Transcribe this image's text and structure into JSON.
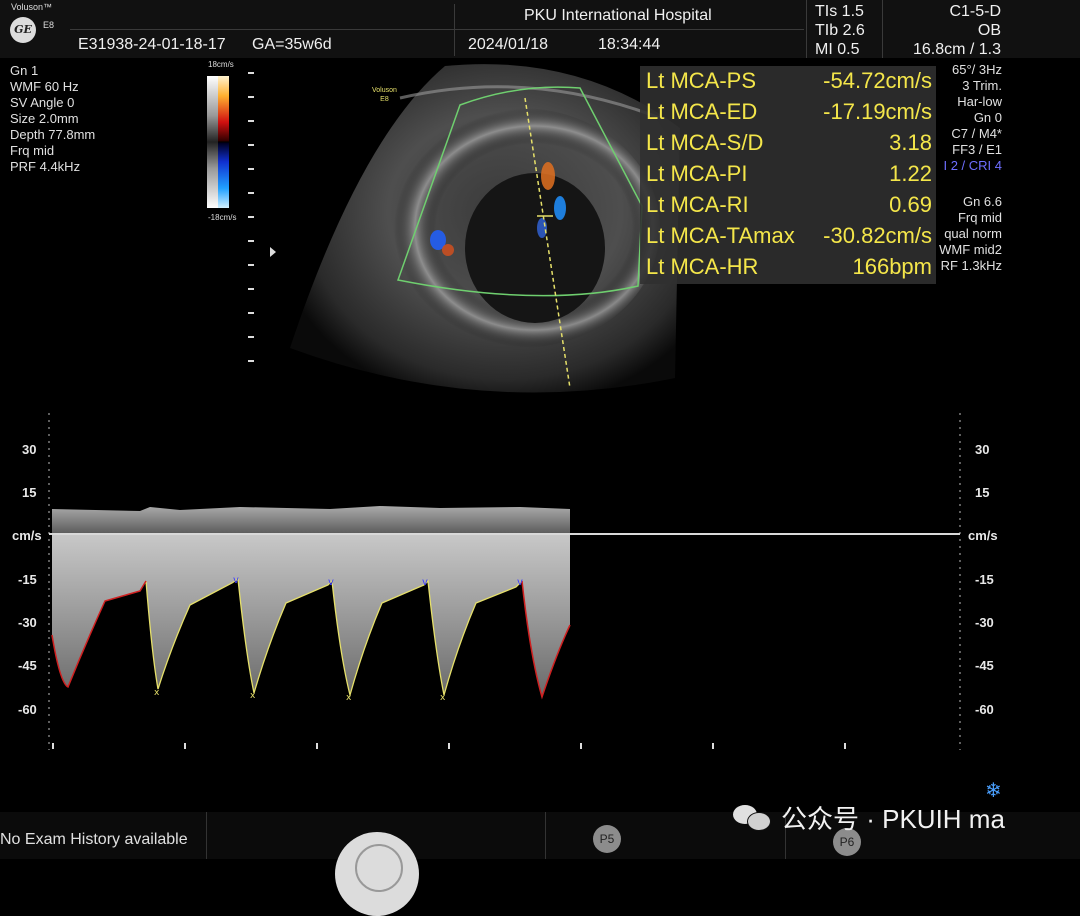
{
  "header": {
    "brand": "Voluson™",
    "brand_model": "E8",
    "logo": "GE",
    "patient_id": "E31938-24-01-18-17",
    "ga": "GA=35w6d",
    "hospital": "PKU International Hospital",
    "date": "2024/01/18",
    "time": "18:34:44",
    "tis": "TIs  1.5",
    "tib": "TIb  2.6",
    "mi": "MI  0.5",
    "probe": "C1-5-D",
    "preset": "OB",
    "depth_zoom": "16.8cm / 1.3"
  },
  "left_params": [
    "Gn  1",
    "WMF 60 Hz",
    "SV Angle  0",
    "Size  2.0mm",
    "Depth 77.8mm",
    "Frq mid",
    "PRF  4.4kHz"
  ],
  "colorbar": {
    "top": "18cm/s",
    "bottom": "-18cm/s"
  },
  "image_label": {
    "brand": "Voluson",
    "model": "E8"
  },
  "measurements": [
    {
      "label": "Lt MCA-PS",
      "value": "-54.72cm/s"
    },
    {
      "label": "Lt MCA-ED",
      "value": "-17.19cm/s"
    },
    {
      "label": "Lt MCA-S/D",
      "value": "3.18"
    },
    {
      "label": "Lt MCA-PI",
      "value": "1.22"
    },
    {
      "label": "Lt MCA-RI",
      "value": "0.69"
    },
    {
      "label": "Lt MCA-TAmax",
      "value": "-30.82cm/s"
    },
    {
      "label": "Lt MCA-HR",
      "value": "166bpm"
    }
  ],
  "right_params": [
    "65°/  3Hz",
    "3 Trim.",
    "Har-low",
    "Gn  0",
    "C7 / M4*",
    "FF3 / E1",
    "I 2 / CRI 4",
    "Gn  6.6",
    "Frq mid",
    "qual norm",
    "WMF mid2",
    "RF  1.3kHz"
  ],
  "right_params_highlight_color": "#6e6eff",
  "spectrum_axis": {
    "unit": "cm/s",
    "ticks": [
      "30",
      "15",
      "-15",
      "-30",
      "-45",
      "-60"
    ],
    "tick_values": [
      30,
      15,
      -15,
      -30,
      -45,
      -60
    ],
    "baseline": 0
  },
  "bottom": {
    "history": "No Exam History available",
    "p5": "P5",
    "p6": "P6",
    "watermark": "公众号 · PKUIH ma"
  },
  "icons": {
    "snowflake": "❄",
    "wechat": "wechat-icon"
  }
}
